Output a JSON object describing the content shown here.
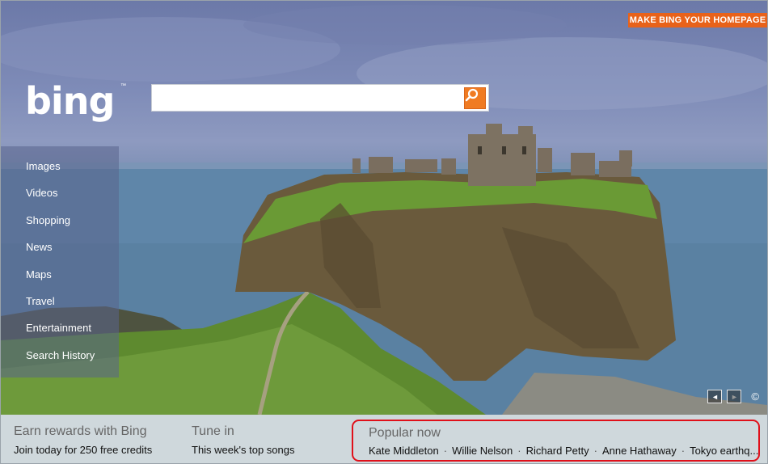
{
  "header": {
    "homepage_button": "MAKE BING YOUR HOMEPAGE",
    "logo": "bing",
    "logo_tm": "™"
  },
  "search": {
    "value": "",
    "placeholder": "",
    "icon": "search-icon"
  },
  "nav": {
    "items": [
      {
        "label": "Images"
      },
      {
        "label": "Videos"
      },
      {
        "label": "Shopping"
      },
      {
        "label": "News"
      },
      {
        "label": "Maps"
      },
      {
        "label": "Travel"
      },
      {
        "label": "Entertainment"
      },
      {
        "label": "Search History"
      }
    ]
  },
  "photo_controls": {
    "prev_icon": "◄",
    "next_icon": "►",
    "copyright": "©"
  },
  "footer": {
    "rewards": {
      "head": "Earn rewards with Bing",
      "sub": "Join today for 250 free credits"
    },
    "tune": {
      "head": "Tune in",
      "sub": "This week's top songs"
    },
    "popular": {
      "head": "Popular now",
      "items": [
        "Kate Middleton",
        "Willie Nelson",
        "Richard Petty",
        "Anne Hathaway",
        "Tokyo earthq..."
      ],
      "separator": "·"
    }
  },
  "colors": {
    "accent_orange": "#e8621a",
    "highlight_red": "#e0101a",
    "footer_bg": "#cfd8dc"
  }
}
